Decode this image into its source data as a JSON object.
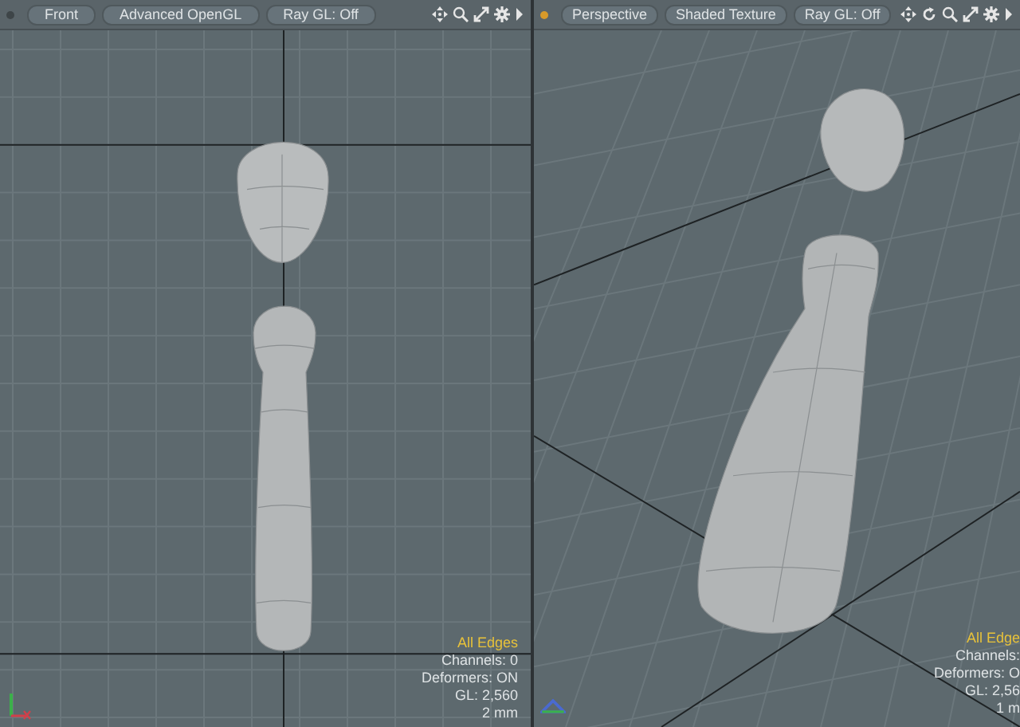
{
  "viewports": [
    {
      "selected": false,
      "buttons": [
        "Front",
        "Advanced OpenGL",
        "Ray GL: Off"
      ],
      "tools": [
        {
          "kind": "pan"
        },
        {
          "kind": "zoom"
        },
        {
          "kind": "maximize"
        },
        {
          "kind": "settings"
        },
        {
          "kind": "more"
        }
      ],
      "kind": "front",
      "info": {
        "mode": "All Edges",
        "lines": [
          "Channels: 0",
          "Deformers: ON",
          "GL: 2,560",
          "2 mm"
        ]
      }
    },
    {
      "selected": true,
      "buttons": [
        "Perspective",
        "Shaded Texture",
        "Ray GL: Off"
      ],
      "tools": [
        {
          "kind": "pan"
        },
        {
          "kind": "rotate"
        },
        {
          "kind": "zoom"
        },
        {
          "kind": "maximize"
        },
        {
          "kind": "settings"
        },
        {
          "kind": "more"
        }
      ],
      "kind": "perspective",
      "info": {
        "mode": "All Edge",
        "lines": [
          "Channels:",
          "Deformers: O",
          "GL: 2,56",
          "1 m"
        ]
      }
    }
  ]
}
